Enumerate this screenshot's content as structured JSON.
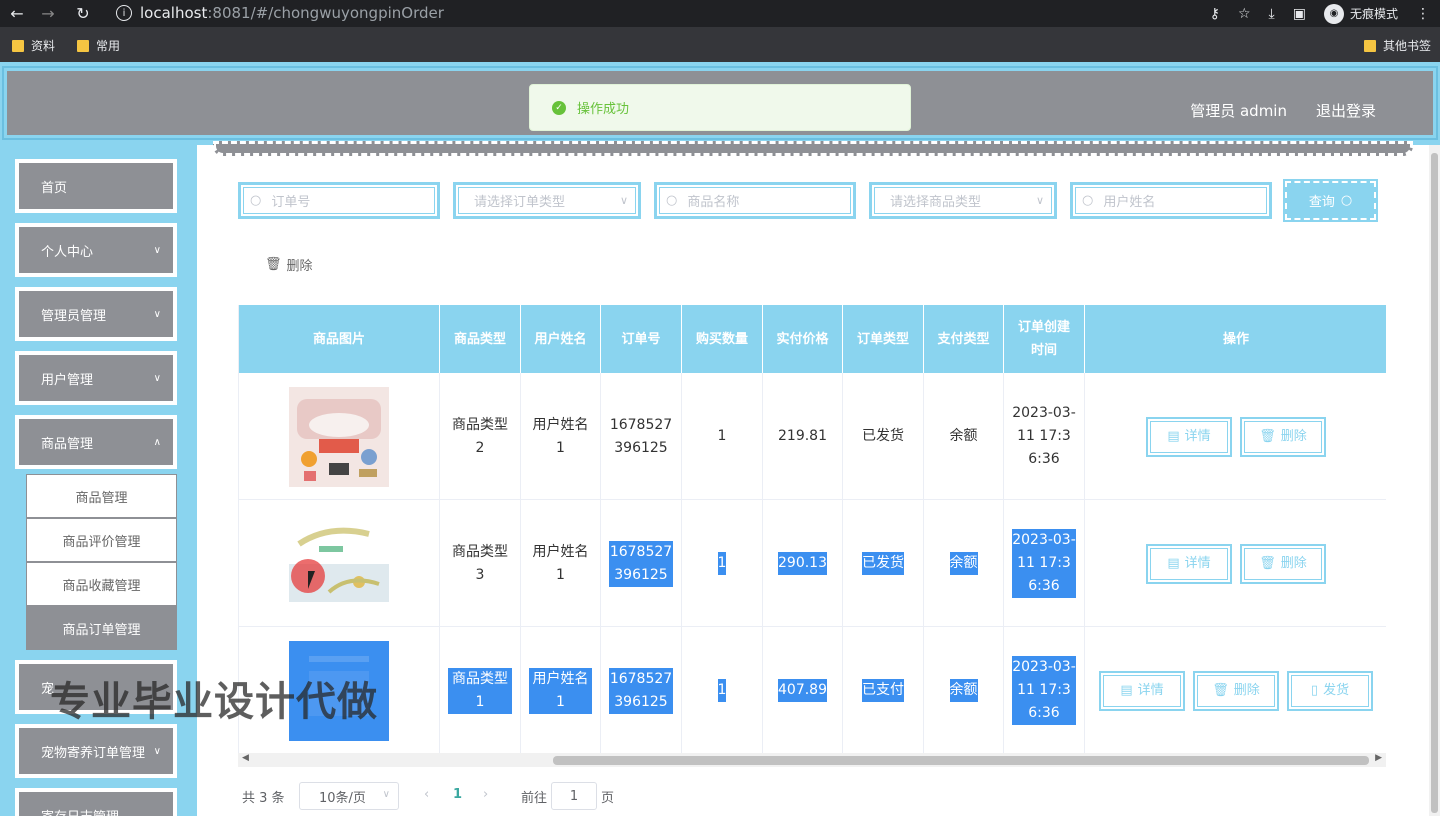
{
  "browser": {
    "url_host": "localhost",
    "url_rest": ":8081/#/chongwuyongpinOrder",
    "incognito_label": "无痕模式",
    "bookmarks": [
      "资料",
      "常用"
    ],
    "other_bookmarks": "其他书签"
  },
  "header": {
    "user_label": "管理员 admin",
    "logout_label": "退出登录"
  },
  "toast": {
    "message": "操作成功"
  },
  "sidebar": {
    "items": [
      {
        "label": "首页"
      },
      {
        "label": "个人中心"
      },
      {
        "label": "管理员管理"
      },
      {
        "label": "用户管理"
      },
      {
        "label": "商品管理"
      },
      {
        "label": "宠"
      },
      {
        "label": "宠物寄养订单管理"
      },
      {
        "label": "寄存日志管理"
      }
    ],
    "submenu": [
      {
        "label": "商品管理"
      },
      {
        "label": "商品评价管理"
      },
      {
        "label": "商品收藏管理"
      },
      {
        "label": "商品订单管理"
      }
    ]
  },
  "filters": {
    "order_no_placeholder": "订单号",
    "order_type_placeholder": "请选择订单类型",
    "product_name_placeholder": "商品名称",
    "product_type_placeholder": "请选择商品类型",
    "user_name_placeholder": "用户姓名",
    "query_label": "查询"
  },
  "toolbar": {
    "delete_label": "删除"
  },
  "table": {
    "headers": [
      "商品图片",
      "商品类型",
      "用户姓名",
      "订单号",
      "购买数量",
      "实付价格",
      "订单类型",
      "支付类型",
      "订单创建时间",
      "操作"
    ],
    "rows": [
      {
        "type": "商品类型2",
        "user": "用户姓名1",
        "order_no": "1678527396125",
        "qty": "1",
        "price": "219.81",
        "order_type": "已发货",
        "pay_type": "余额",
        "created": "2023-03-11 17:36:36"
      },
      {
        "type": "商品类型3",
        "user": "用户姓名1",
        "order_no": "1678527396125",
        "qty": "1",
        "price": "290.13",
        "order_type": "已发货",
        "pay_type": "余额",
        "created": "2023-03-11 17:36:36"
      },
      {
        "type": "商品类型1",
        "user": "用户姓名1",
        "order_no": "1678527396125",
        "qty": "1",
        "price": "407.89",
        "order_type": "已支付",
        "pay_type": "余额",
        "created": "2023-03-11 17:36:36"
      }
    ],
    "actions": {
      "detail": "详情",
      "delete": "删除",
      "ship": "发货"
    }
  },
  "pagination": {
    "total": "共 3 条",
    "page_size": "10条/页",
    "current_page": "1",
    "goto_label": "前往",
    "goto_value": "1",
    "page_unit": "页"
  },
  "watermark": "专业毕业设计代做",
  "colors": {
    "accent": "#8ad4ef",
    "menu": "#8e9095",
    "selection": "#3b8ff0",
    "success": "#67c23a"
  }
}
